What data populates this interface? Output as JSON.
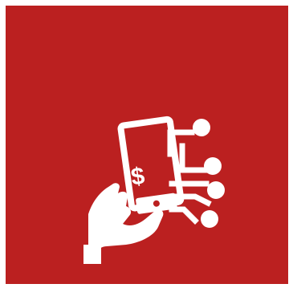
{
  "tile": {
    "background_color": "#BB2020",
    "foreground_color": "#FFFFFF"
  },
  "icon": {
    "name": "fintech-mobile-payment-icon",
    "symbol": "$"
  }
}
